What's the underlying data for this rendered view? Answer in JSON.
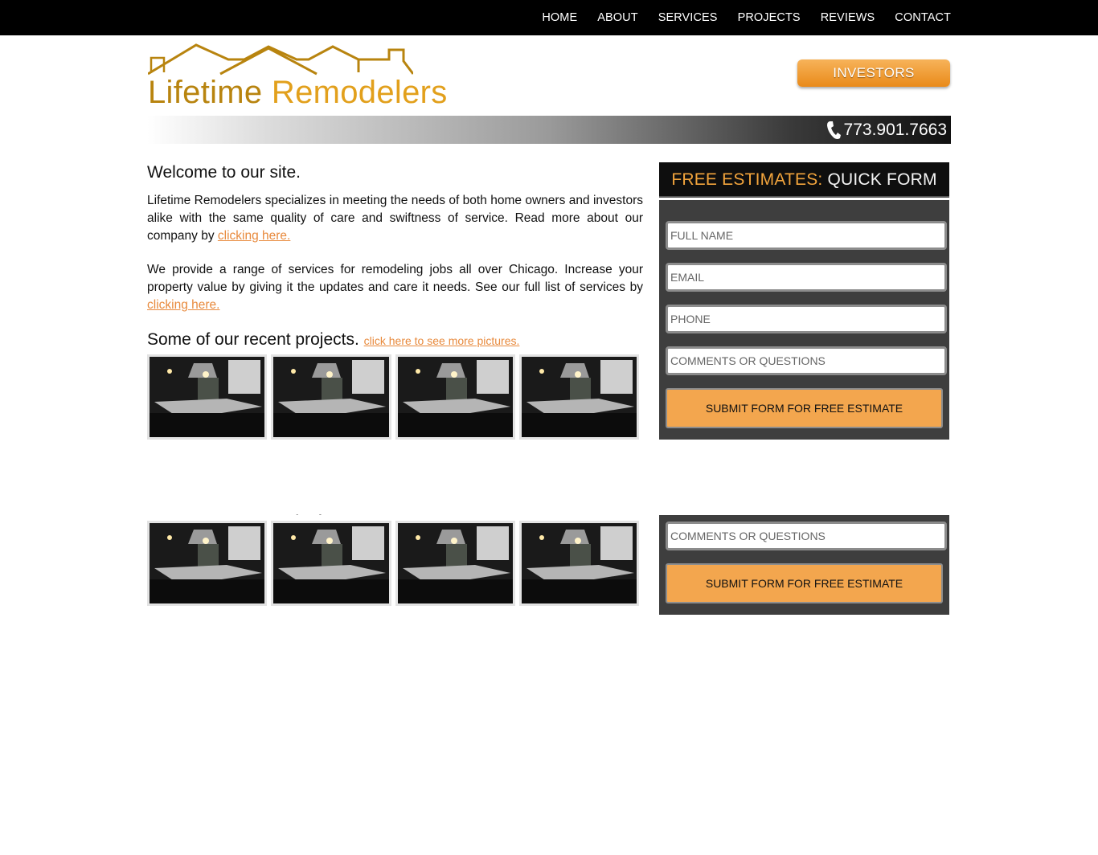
{
  "nav": {
    "items": [
      {
        "label": "HOME"
      },
      {
        "label": "ABOUT"
      },
      {
        "label": "SERVICES"
      },
      {
        "label": "PROJECTS"
      },
      {
        "label": "REVIEWS"
      },
      {
        "label": "CONTACT"
      }
    ]
  },
  "header": {
    "logo_word1": "Lifetime",
    "logo_word2": "Remodelers",
    "investors_label": "INVESTORS",
    "phone": "773.901.7663"
  },
  "main": {
    "welcome": "Welcome to our site.",
    "para1": "Lifetime Remodelers specializes in meeting the needs of both home owners and investors alike with the same quality of care and swiftness of service. Read more about our company by ",
    "para1_link": "clicking here.",
    "para2": "We provide a range of services for remodeling jobs all over Chicago. Increase your property value by giving it the updates and care it needs. See our full list of services by ",
    "para2_link": "clicking here.",
    "projects_title": "Some of our recent projects.",
    "projects_link": "click here to see more pictures."
  },
  "form": {
    "title_accent": "FREE ESTIMATES:",
    "title_rest": "QUICK FORM",
    "full_name": "FULL NAME",
    "email": "EMAIL",
    "phone": "PHONE",
    "comments": "COMMENTS OR QUESTIONS",
    "submit": "SUBMIT FORM FOR FREE ESTIMATE"
  },
  "colors": {
    "accent_orange": "#f2a43c",
    "link_orange": "#e88a3d",
    "logo_gold": "#b8840f"
  }
}
